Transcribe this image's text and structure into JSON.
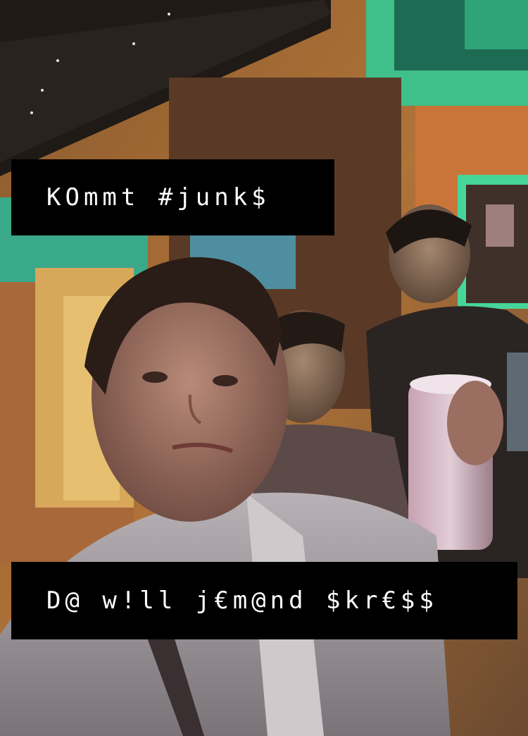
{
  "captions": {
    "top": "KOmmt #junk$",
    "bottom": "D@ w!ll j€m@nd $kr€$$"
  }
}
